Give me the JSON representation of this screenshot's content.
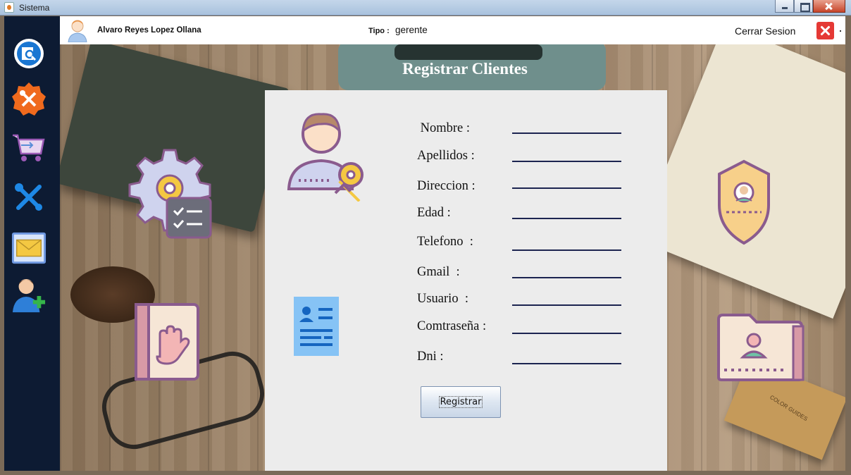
{
  "window": {
    "title": "Sistema"
  },
  "header": {
    "user_name": "Alvaro Reyes Lopez Ollana",
    "tipo_label": "Tipo :",
    "tipo_value": "gerente",
    "logout_label": "Cerrar Sesion"
  },
  "sidebar": {
    "items": [
      {
        "icon": "search-report-icon"
      },
      {
        "icon": "tools-badge-icon"
      },
      {
        "icon": "shopping-cart-icon"
      },
      {
        "icon": "wrench-screwdriver-icon"
      },
      {
        "icon": "mail-icon"
      },
      {
        "icon": "add-user-icon"
      }
    ]
  },
  "page": {
    "title": "Registrar Clientes"
  },
  "form": {
    "fields": [
      {
        "label": " Nombre :",
        "value": ""
      },
      {
        "label": "Apellidos :",
        "value": ""
      },
      {
        "label": "Direccion :",
        "value": ""
      },
      {
        "label": "Edad :",
        "value": ""
      },
      {
        "label": "Telefono  :",
        "value": ""
      },
      {
        "label": "Gmail  :",
        "value": ""
      },
      {
        "label": "Usuario  :",
        "value": ""
      },
      {
        "label": "Comtraseña :",
        "value": ""
      },
      {
        "label": "Dni :",
        "value": ""
      }
    ],
    "submit_label": "Registrar"
  },
  "colors": {
    "sidebar_bg": "#0d1b33",
    "panel_bg": "#ececec",
    "logout_red": "#e53935",
    "icon_purple": "#8a5b8e",
    "field_underline": "#1c2450"
  }
}
